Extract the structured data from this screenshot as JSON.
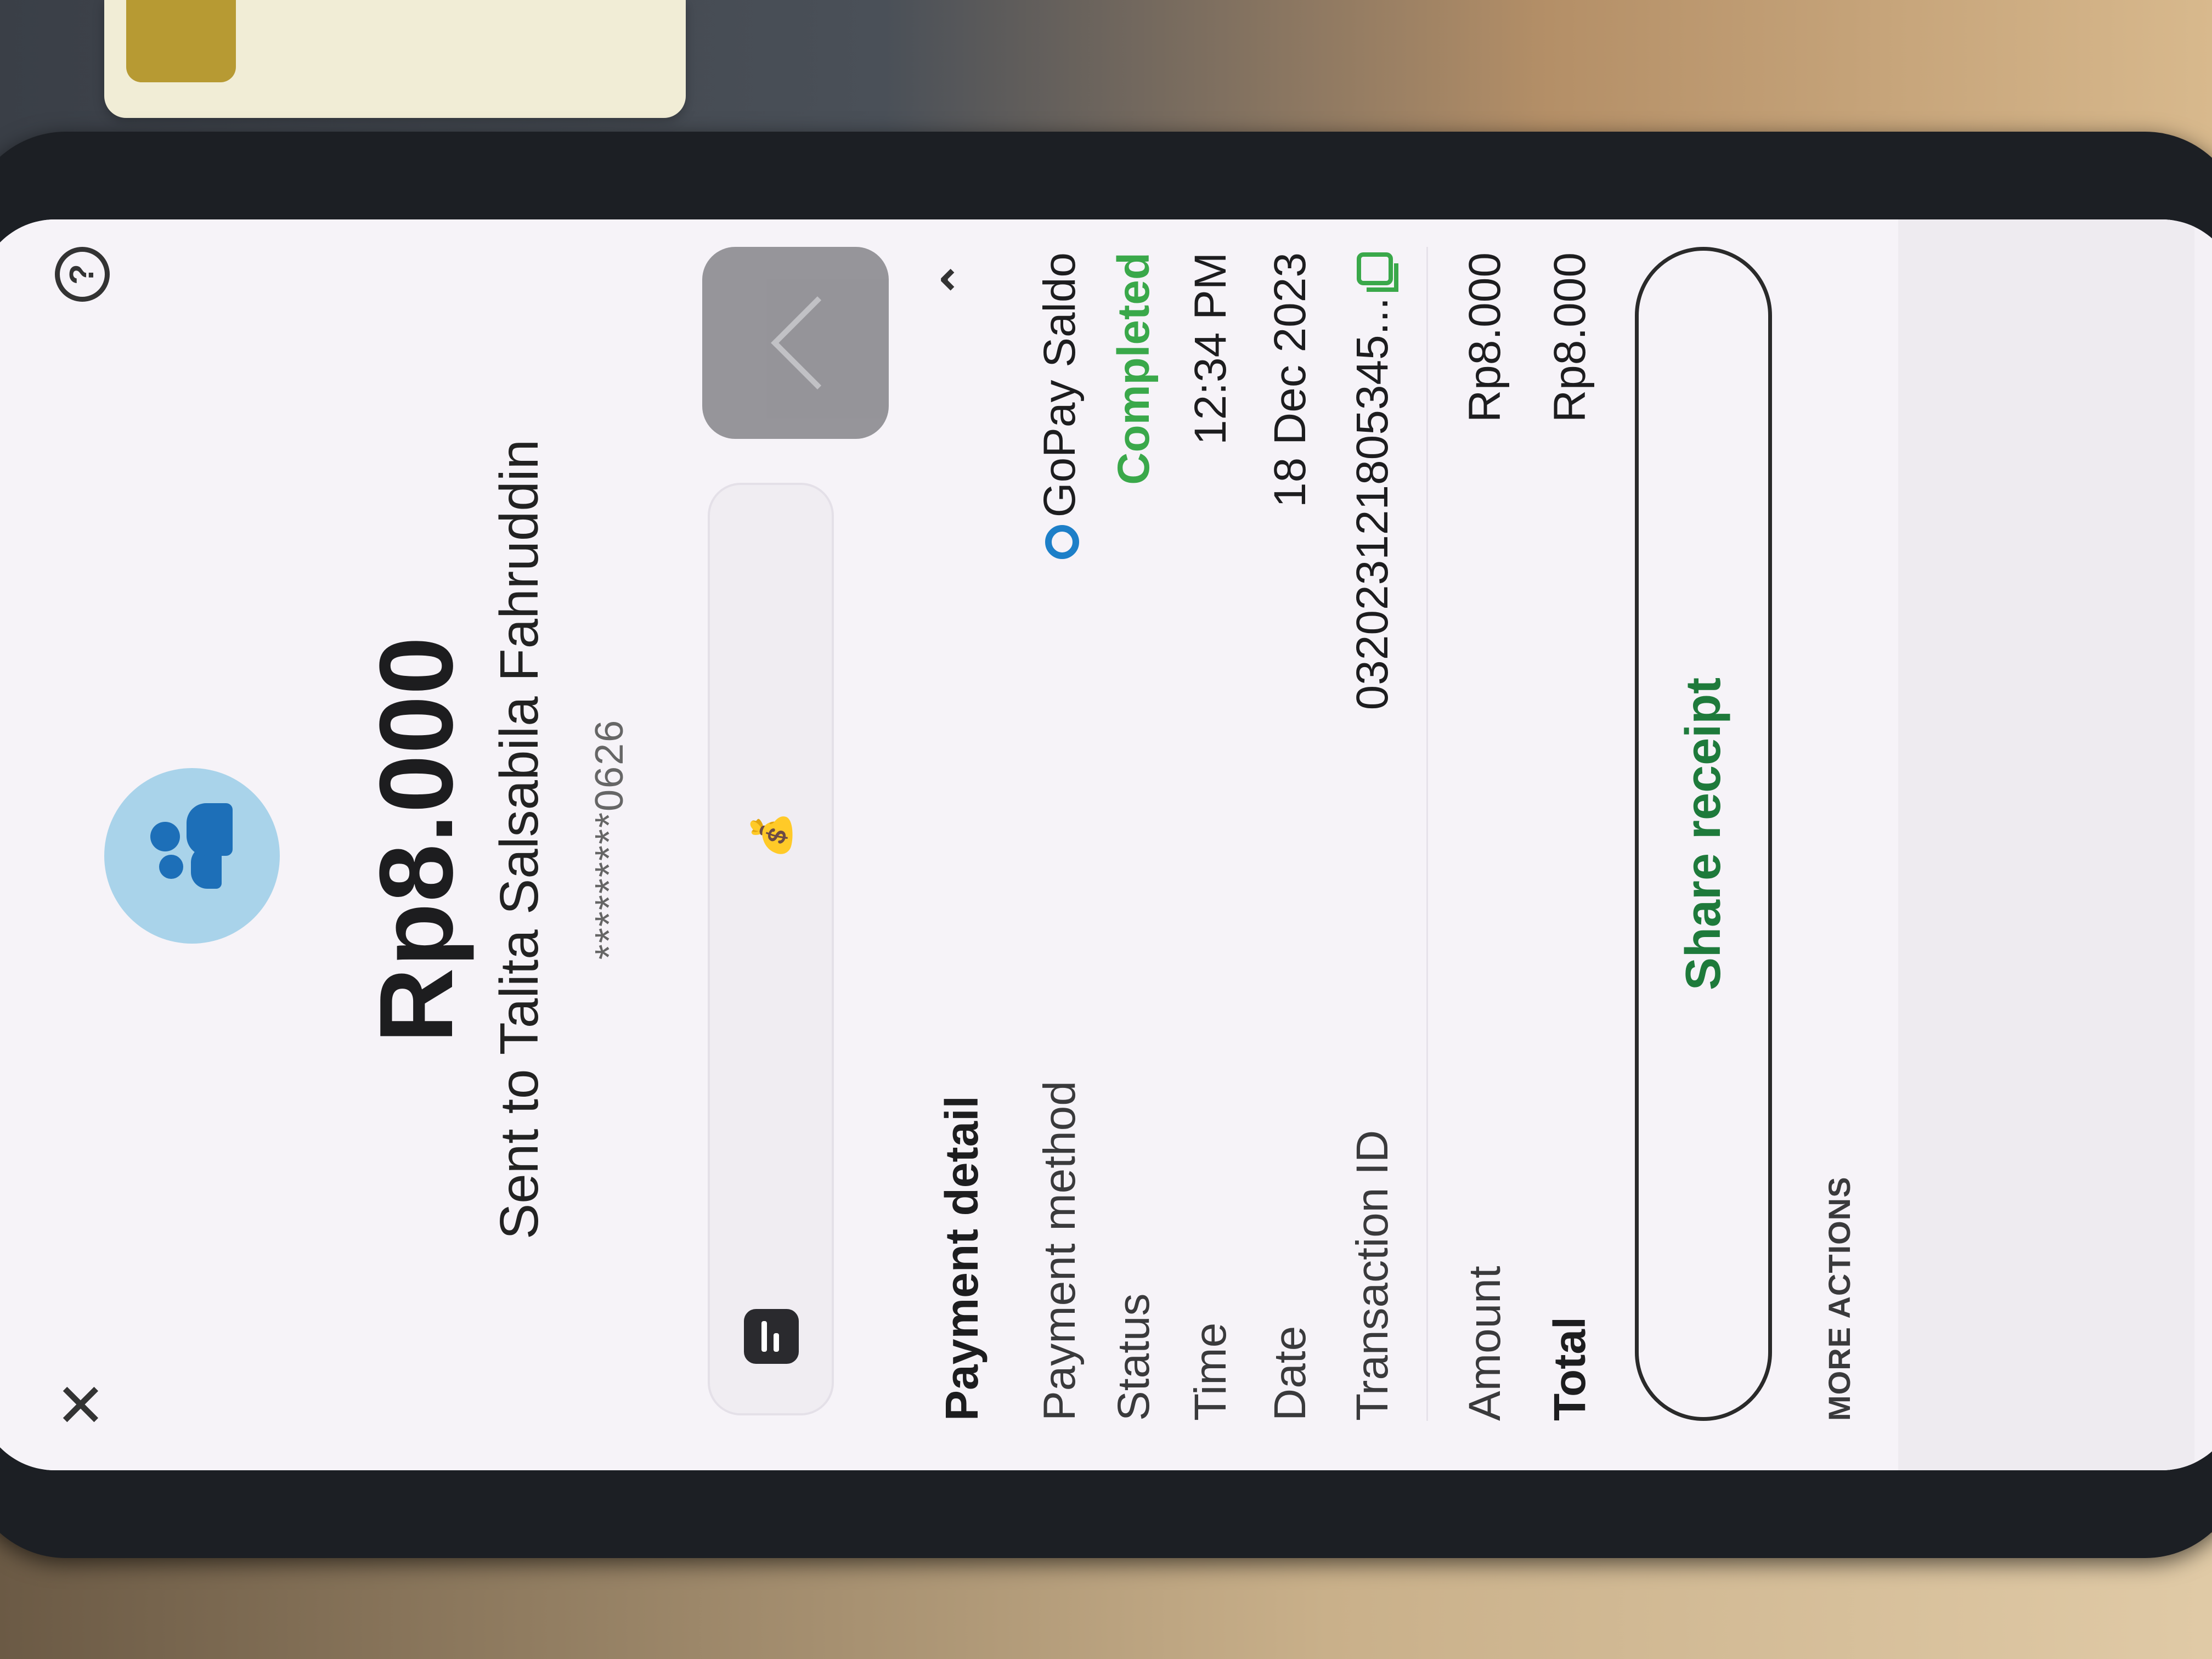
{
  "header": {
    "close_glyph": "✕",
    "help_glyph": "?"
  },
  "summary": {
    "amount": "Rp8.000",
    "recipient": "Sent to Talita Salsabila Fahruddin",
    "account_masked": "*********0626"
  },
  "note_bar": {
    "emoji": "💰"
  },
  "payment_detail": {
    "title": "Payment detail",
    "collapse_glyph": "⌃",
    "rows": [
      {
        "label": "Payment method",
        "value": "GoPay Saldo"
      },
      {
        "label": "Status",
        "value": "Completed"
      },
      {
        "label": "Time",
        "value": "12:34 PM"
      },
      {
        "label": "Date",
        "value": "18 Dec 2023"
      },
      {
        "label": "Transaction ID",
        "value": "032023121805345..."
      },
      {
        "label": "Amount",
        "value": "Rp8.000"
      },
      {
        "label": "Total",
        "value": "Rp8.000"
      }
    ]
  },
  "actions": {
    "share_label": "Share receipt",
    "more_actions_label": "MORE ACTIONS"
  },
  "colors": {
    "status_green": "#3aa84a",
    "gopay_blue": "#1d7fc8",
    "avatar_bg": "#a9d3ea"
  }
}
